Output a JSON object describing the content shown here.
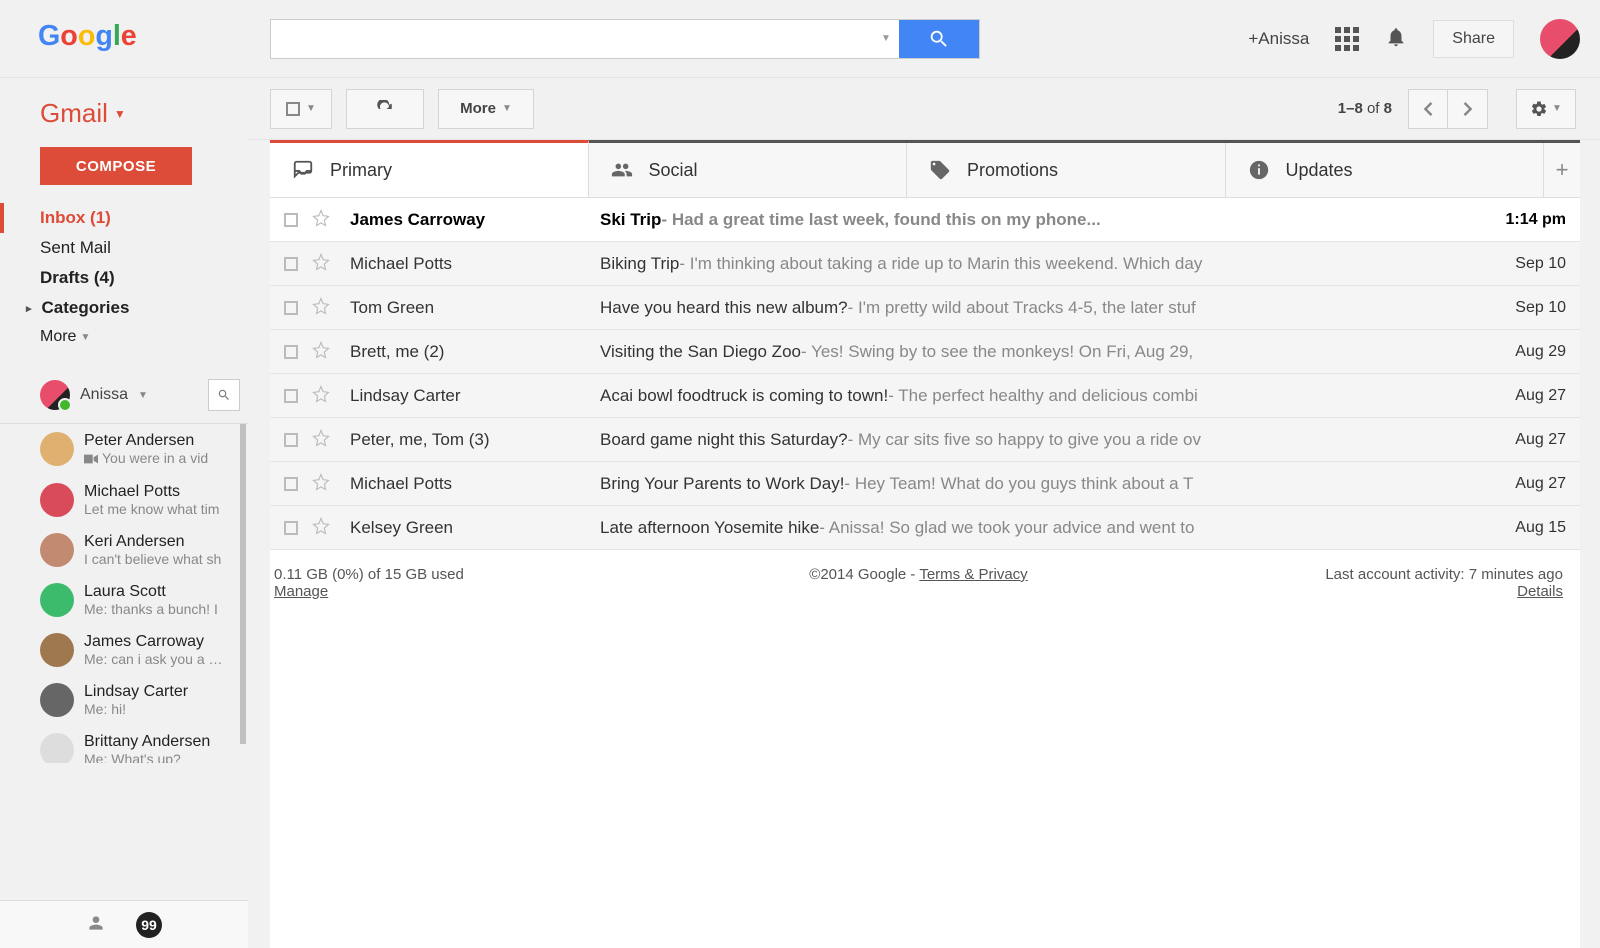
{
  "header": {
    "plus_user": "+Anissa",
    "share_label": "Share"
  },
  "sidebar": {
    "product": "Gmail",
    "compose_label": "COMPOSE",
    "nav": {
      "inbox": "Inbox (1)",
      "sent": "Sent Mail",
      "drafts": "Drafts (4)",
      "categories": "Categories",
      "more": "More"
    },
    "chat_user": "Anissa",
    "chats": [
      {
        "name": "Peter Andersen",
        "msg": "You were in a vid",
        "video": true,
        "color": "#e0b070"
      },
      {
        "name": "Michael Potts",
        "msg": "Let me know what tim",
        "video": false,
        "color": "#d94b5b"
      },
      {
        "name": "Keri Andersen",
        "msg": "I can't believe what sh",
        "video": false,
        "color": "#c28a70"
      },
      {
        "name": "Laura Scott",
        "msg": "Me: thanks a bunch! I",
        "video": false,
        "color": "#3bbb6b"
      },
      {
        "name": "James Carroway",
        "msg": "Me: can i ask you a qu",
        "video": false,
        "color": "#a07850"
      },
      {
        "name": "Lindsay Carter",
        "msg": "Me: hi!",
        "video": false,
        "color": "#666"
      },
      {
        "name": "Brittany Andersen",
        "msg": "Me: What's up?",
        "video": false,
        "color": "#ddd"
      }
    ]
  },
  "toolbar": {
    "more_label": "More",
    "page_range": "1–8",
    "page_of": "of",
    "page_total": "8"
  },
  "tabs": [
    {
      "label": "Primary"
    },
    {
      "label": "Social"
    },
    {
      "label": "Promotions"
    },
    {
      "label": "Updates"
    }
  ],
  "emails": [
    {
      "unread": true,
      "sender": "James Carroway",
      "subject": "Ski Trip",
      "snippet": "Had a great time last week, found this on my phone...",
      "date": "1:14 pm"
    },
    {
      "unread": false,
      "sender": "Michael Potts",
      "subject": "Biking Trip",
      "snippet": "I'm thinking about taking a ride up to Marin this weekend. Which day",
      "date": "Sep 10"
    },
    {
      "unread": false,
      "sender": "Tom Green",
      "subject": "Have you heard this new album?",
      "snippet": "I'm pretty wild about Tracks 4-5, the later stuf",
      "date": "Sep 10"
    },
    {
      "unread": false,
      "sender": "Brett, me (2)",
      "subject": "Visiting the San Diego Zoo",
      "snippet": "Yes! Swing by to see the monkeys! On Fri, Aug 29,",
      "date": "Aug 29"
    },
    {
      "unread": false,
      "sender": "Lindsay Carter",
      "subject": "Acai bowl foodtruck is coming to town!",
      "snippet": "The perfect healthy and delicious combi",
      "date": "Aug 27"
    },
    {
      "unread": false,
      "sender": "Peter, me, Tom (3)",
      "subject": "Board game night this Saturday?",
      "snippet": "My car sits five so happy to give you a ride ov",
      "date": "Aug 27"
    },
    {
      "unread": false,
      "sender": "Michael Potts",
      "subject": "Bring Your Parents to Work Day!",
      "snippet": "Hey Team! What do you guys think about a T",
      "date": "Aug 27"
    },
    {
      "unread": false,
      "sender": "Kelsey Green",
      "subject": "Late afternoon Yosemite hike",
      "snippet": "Anissa! So glad we took your advice and went to",
      "date": "Aug 15"
    }
  ],
  "footer": {
    "storage": "0.11 GB (0%) of 15 GB used",
    "manage": "Manage",
    "copyright": "©2014 Google - ",
    "terms": "Terms & Privacy",
    "activity": "Last account activity: 7 minutes ago",
    "details": "Details"
  }
}
